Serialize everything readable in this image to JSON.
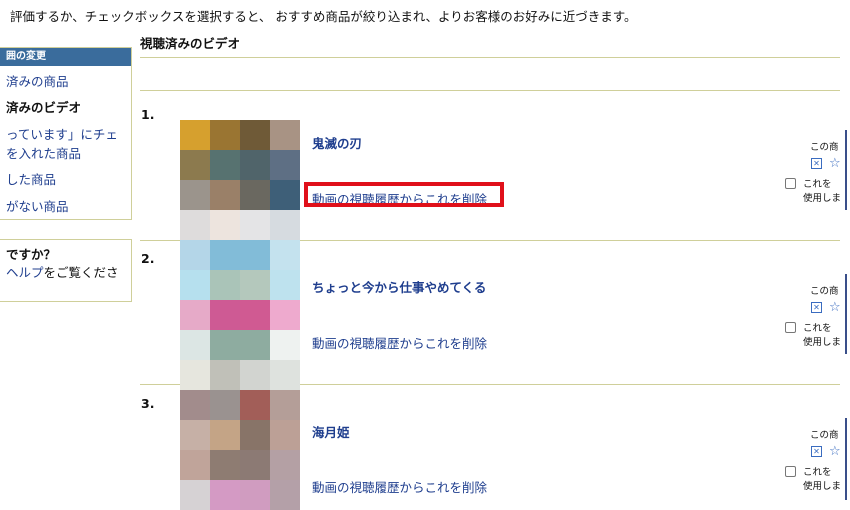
{
  "intro_text": "評価するか、チェックボックスを選択すると、 おすすめ商品が絞り込まれ、よりお客様のお好みに近づきます。",
  "sidebar": {
    "header": "囲の変更",
    "items": [
      {
        "label": "済みの商品",
        "current": false
      },
      {
        "label": "済みのビデオ",
        "current": true
      },
      {
        "label": "っています」にチェ",
        "current": false
      },
      {
        "label": "を入れた商品",
        "current": false
      },
      {
        "label": "した商品",
        "current": false
      },
      {
        "label": "がない商品",
        "current": false
      }
    ],
    "help": {
      "title": "ですか？",
      "link": "ヘルプ",
      "text": "をご覧くださ"
    }
  },
  "section_title": "視聴済みのビデオ",
  "videos": [
    {
      "rank": "1.",
      "title": "鬼滅の刃",
      "remove_link": "動画の視聴履歴からこれを削除",
      "thumb_colors": [
        "#d6a02e",
        "#9a7532",
        "#6f5a37",
        "#a89384",
        "#8c7a4e",
        "#577270",
        "#50646a",
        "#5e6f84",
        "#9b948c",
        "#9a8068",
        "#6a6860",
        "#3e5f78",
        "#dedcdc",
        "#ede4de",
        "#e4e4e6",
        "#d6dbe0"
      ]
    },
    {
      "rank": "2.",
      "title": "ちょっと今から仕事やめてくる",
      "remove_link": "動画の視聴履歴からこれを削除",
      "thumb_colors": [
        "#b4d6e8",
        "#82bcd8",
        "#82bcd8",
        "#c4e2ee",
        "#b6e0ee",
        "#aac4b8",
        "#b4c8bc",
        "#bee2ee",
        "#e6aac8",
        "#ce5a94",
        "#d05a92",
        "#eeaace",
        "#dce6e4",
        "#8eaca0",
        "#8eaca0",
        "#eef2f0"
      ]
    },
    {
      "rank": "3.",
      "title": "海月姫",
      "remove_link": "動画の視聴履歴からこれを削除",
      "thumb_colors": [
        "#e6e6de",
        "#c0c0b8",
        "#d2d4d0",
        "#dee2de",
        "#a28c8c",
        "#9a9290",
        "#a25e58",
        "#b49e98",
        "#c6b0a6",
        "#c4a486",
        "#887468",
        "#bca096",
        "#c0a49a",
        "#8e7c72",
        "#8c7a74",
        "#b4a0a4",
        "#d6d2d4",
        "#d49ac4",
        "#d09cc0",
        "#b4a0a8"
      ]
    }
  ],
  "right_panel": {
    "label_top": "この商",
    "label_line1": "これを",
    "label_line2": "使用しま"
  }
}
